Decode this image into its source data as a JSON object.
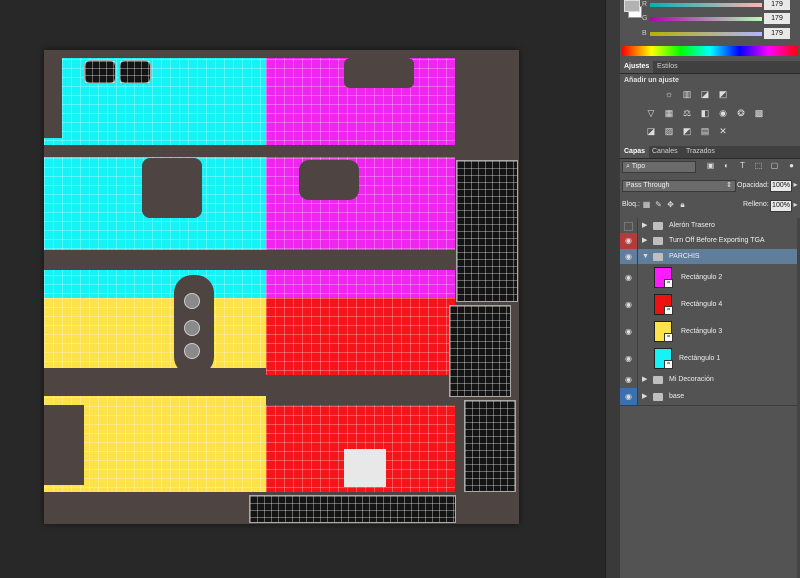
{
  "canvas": {
    "quadrant_colors": {
      "cyan": "#16f3f7",
      "magenta": "#ef26ef",
      "yellow": "#fde24a",
      "red": "#f5141a"
    },
    "background": "#4e4542"
  },
  "color_panel": {
    "sliders": [
      {
        "label": "R",
        "value": "179",
        "gradient": "linear-gradient(90deg,#00b3b3,#ffb3b3)"
      },
      {
        "label": "G",
        "value": "179",
        "gradient": "linear-gradient(90deg,#b300b3,#b3ffb3)"
      },
      {
        "label": "B",
        "value": "179",
        "gradient": "linear-gradient(90deg,#b3b300,#b3b3ff)"
      }
    ]
  },
  "adjustments": {
    "tabs": [
      "Ajustes",
      "Estilos"
    ],
    "title": "Añadir un ajuste",
    "icons": [
      "brightness-icon",
      "levels-icon",
      "curves-icon",
      "exposure-icon",
      "vibrance-icon",
      "hue-sat-icon",
      "color-balance-icon",
      "bw-icon",
      "photo-filter-icon",
      "channel-mixer-icon",
      "color-lookup-icon",
      "invert-icon",
      "posterize-icon",
      "threshold-icon",
      "gradient-map-icon",
      "selective-color-icon"
    ]
  },
  "layers_panel": {
    "tabs": [
      "Capas",
      "Canales",
      "Trazados"
    ],
    "filter_kind": "Tipo",
    "blend_mode": "Pass Through",
    "opacity_label": "Opacidad:",
    "opacity_value": "100%",
    "lock_label": "Bloq.:",
    "fill_label": "Relleno:",
    "fill_value": "100%",
    "layers": [
      {
        "name": "Alerón Trasero",
        "type": "group",
        "visible": false,
        "eye": "none"
      },
      {
        "name": "Turn Off Before Exporting TGA",
        "type": "group",
        "visible": true,
        "eye": "red"
      },
      {
        "name": "PARCHIS",
        "type": "group-open",
        "visible": true,
        "eye": "none",
        "selected": true
      },
      {
        "name": "Rectángulo 2",
        "type": "shape",
        "visible": true,
        "eye": "none",
        "color": "#ff1aff"
      },
      {
        "name": "Rectángulo 4",
        "type": "shape",
        "visible": true,
        "eye": "none",
        "color": "#ee1111"
      },
      {
        "name": "Rectángulo 3",
        "type": "shape",
        "visible": true,
        "eye": "none",
        "color": "#fde24a"
      },
      {
        "name": "Rectángulo 1",
        "type": "shape",
        "visible": true,
        "eye": "none",
        "color": "#16f3f7"
      },
      {
        "name": "Mi Decoración",
        "type": "group",
        "visible": true,
        "eye": "none"
      },
      {
        "name": "base",
        "type": "group",
        "visible": true,
        "eye": "blue"
      }
    ]
  }
}
